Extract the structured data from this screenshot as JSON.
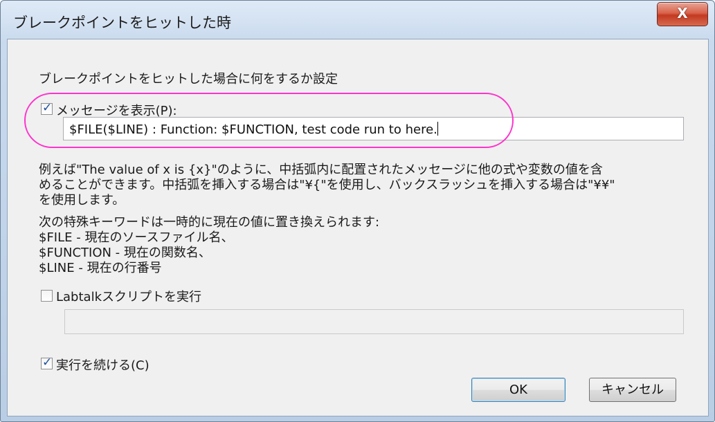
{
  "window": {
    "title": "ブレークポイントをヒットした時",
    "close_glyph": "X"
  },
  "heading": "ブレークポイントをヒットした場合に何をするか設定",
  "message_option": {
    "label": "メッセージを表示(P):",
    "checked": true,
    "value": "$FILE($LINE) : Function: $FUNCTION, test code run to here."
  },
  "description": {
    "lines": [
      "例えば\"The value of x is {x}\"のように、中括弧内に配置されたメッセージに他の式や変数の値を含",
      "めることができます。中括弧を挿入する場合は\"¥{\"を使用し、バックスラッシュを挿入する場合は\"¥¥\"",
      "を使用します。"
    ]
  },
  "keywords": {
    "intro": "次の特殊キーワードは一時的に現在の値に置き換えられます:",
    "items": [
      "$FILE - 現在のソースファイル名、",
      "$FUNCTION - 現在の関数名、",
      "$LINE - 現在の行番号"
    ]
  },
  "script_option": {
    "label": "Labtalkスクリプトを実行",
    "checked": false,
    "value": ""
  },
  "continue_option": {
    "label": "実行を続ける(C)",
    "checked": true
  },
  "buttons": {
    "ok": "OK",
    "cancel": "キャンセル"
  },
  "colors": {
    "highlight": "#ff33cc",
    "close_button": "#c94a32"
  }
}
